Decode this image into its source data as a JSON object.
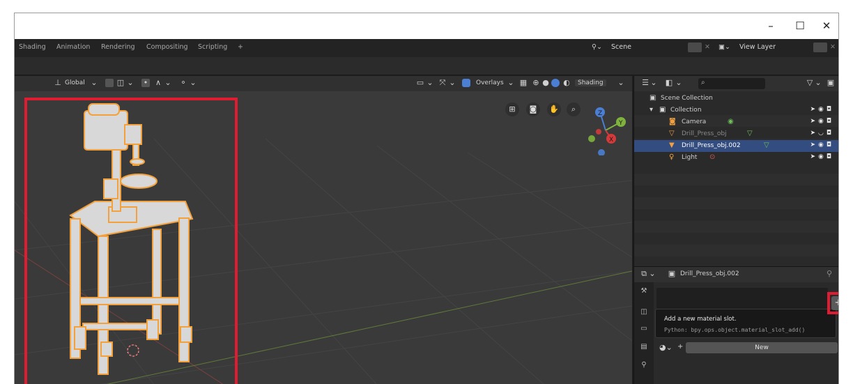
{
  "window": {
    "minimize": "–",
    "maximize": "☐",
    "close": "✕"
  },
  "workspaces": {
    "tabs": [
      "Shading",
      "Animation",
      "Rendering",
      "Compositing",
      "Scripting"
    ],
    "add": "+",
    "scene_label": "Scene",
    "view_layer_label": "View Layer"
  },
  "viewport": {
    "transform_orientation": "Global",
    "overlays_label": "Overlays",
    "shading_label": "Shading",
    "gizmo_axes": {
      "z": "Z",
      "y": "Y",
      "x": "X"
    }
  },
  "outliner": {
    "search_placeholder": "",
    "rows": [
      {
        "label": "Scene Collection"
      },
      {
        "label": "Collection"
      },
      {
        "label": "Camera"
      },
      {
        "label": "Drill_Press_obj"
      },
      {
        "label": "Drill_Press_obj.002"
      },
      {
        "label": "Light"
      }
    ]
  },
  "properties": {
    "object_name": "Drill_Press_obj.002",
    "add_slot_button": "+",
    "tooltip": {
      "title": "Add a new material slot.",
      "python": "Python: bpy.ops.object.material_slot_add()"
    },
    "new_button": "New",
    "plus": "+"
  },
  "colors": {
    "highlight": "#e01c32",
    "selection": "#334d80",
    "outline_orange": "#f2a13c"
  }
}
